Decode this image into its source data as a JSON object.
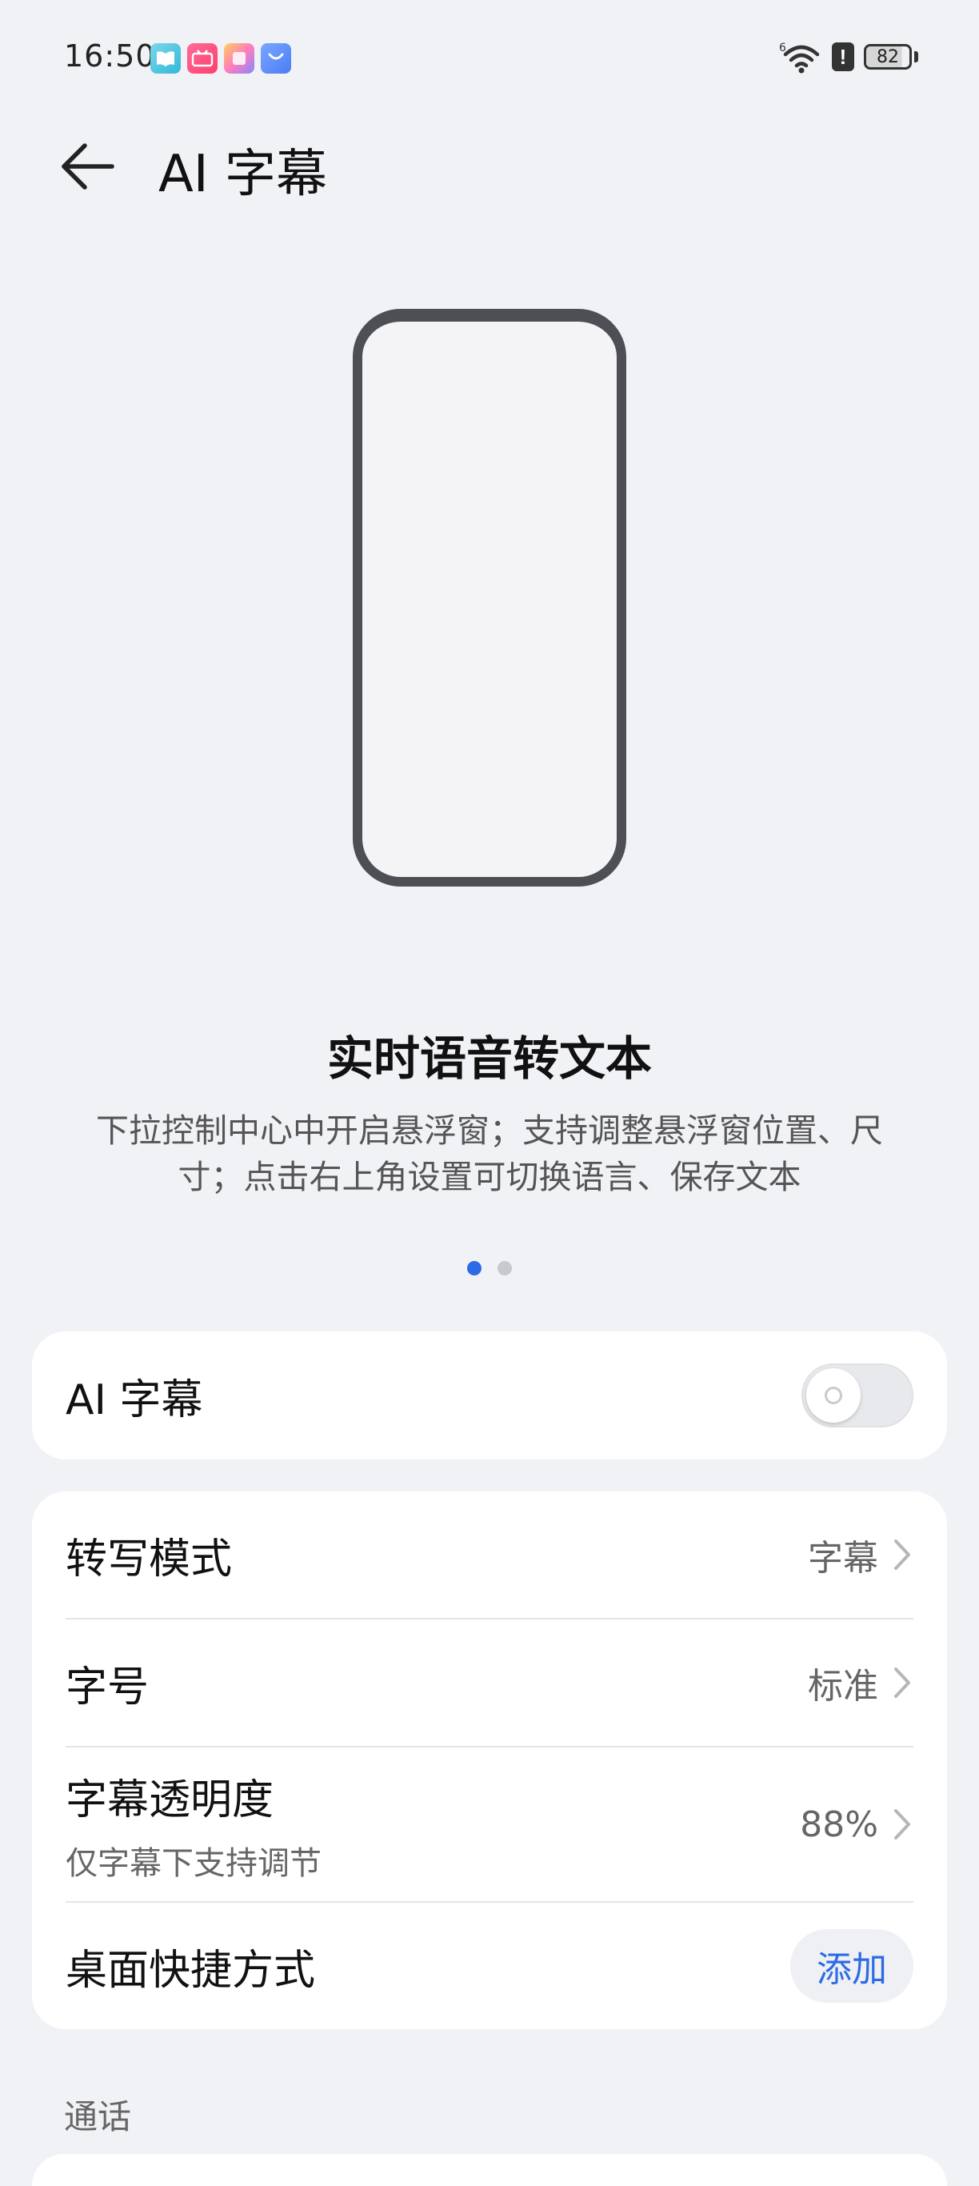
{
  "status_bar": {
    "time": "16:50",
    "battery_level": "82",
    "app_icons": [
      "book-app-icon",
      "bilibili-app-icon",
      "gallery-app-icon",
      "app-store-icon"
    ],
    "signal_label": "6"
  },
  "header": {
    "title": "AI 字幕",
    "back_icon": "arrow-left-icon"
  },
  "carousel": {
    "title": "实时语音转文本",
    "description": "下拉控制中心中开启悬浮窗；支持调整悬浮窗位置、尺寸；点击右上角设置可切换语言、保存文本",
    "page_count": 2,
    "active_page": 1
  },
  "toggle_card": {
    "label": "AI 字幕",
    "enabled": false
  },
  "settings": {
    "transcription_mode": {
      "label": "转写模式",
      "value": "字幕"
    },
    "font_size": {
      "label": "字号",
      "value": "标准"
    },
    "transparency": {
      "label": "字幕透明度",
      "sublabel": "仅字幕下支持调节",
      "value": "88%"
    },
    "shortcut": {
      "label": "桌面快捷方式",
      "button": "添加"
    }
  },
  "section": {
    "calls_header": "通话"
  },
  "colors": {
    "accent": "#2d6be4",
    "background": "#f1f2f6",
    "card": "#ffffff"
  }
}
